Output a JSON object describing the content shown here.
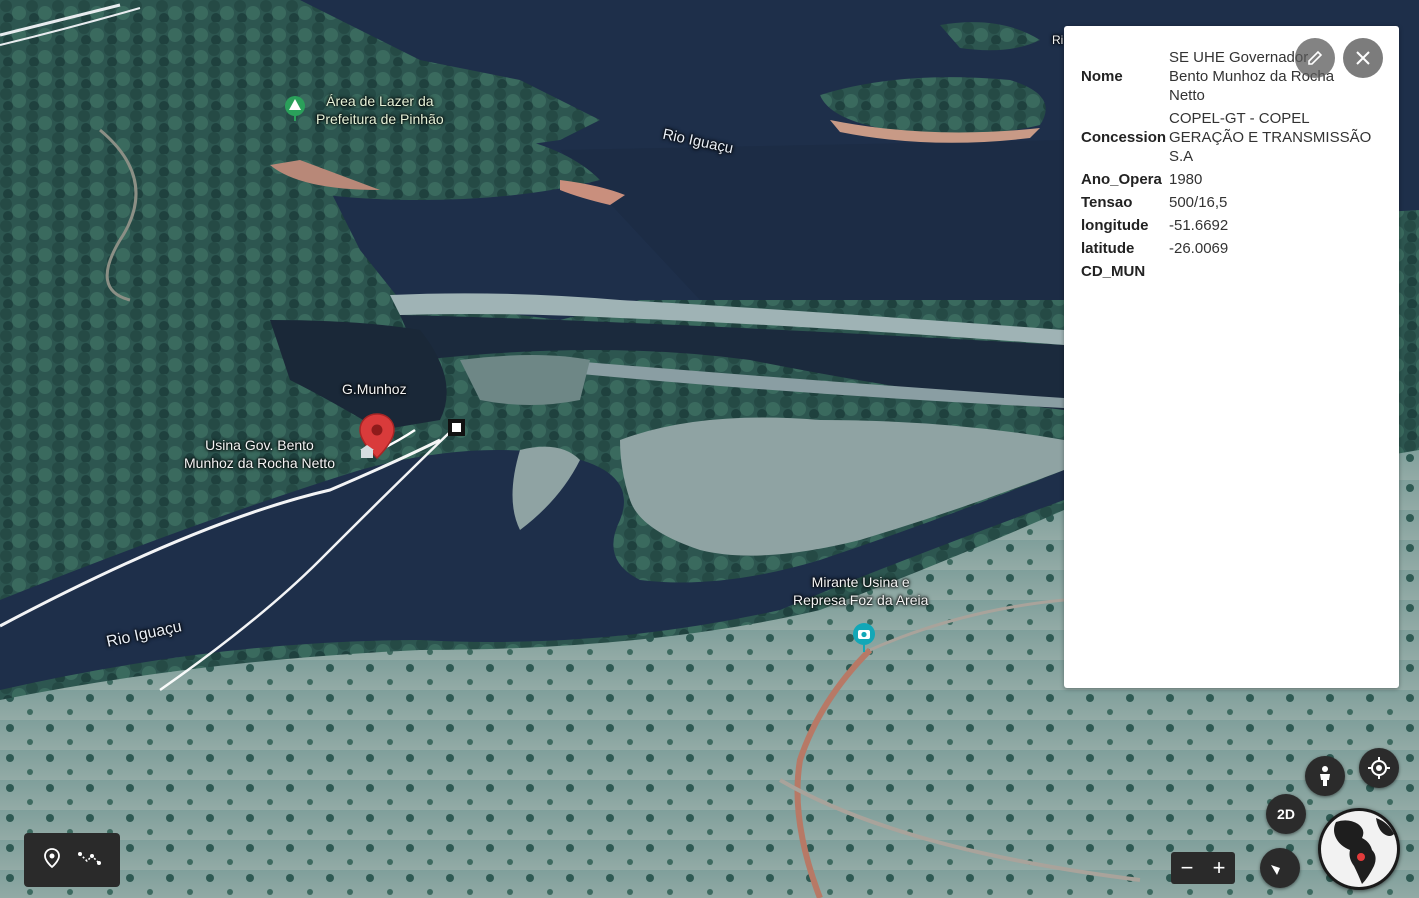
{
  "map": {
    "labels": {
      "area_lazer": "Área de Lazer da\nPrefeitura de Pinhão",
      "rio_iguacu_top": "Rio Iguaçu",
      "rio_iguacu_bottom": "Rio Iguaçu",
      "g_munhoz": "G.Munhoz",
      "usina": "Usina Gov. Bento\nMunhoz da Rocha Netto",
      "mirante": "Mirante Usina e\nRepresa Foz da Areia",
      "corner_partial": "Ri"
    },
    "colors": {
      "water": "#1e2f4a",
      "forest": "#2f5a52",
      "field": "#8aa7a4",
      "marker": "#d93b3b"
    }
  },
  "info_panel": {
    "rows": [
      {
        "key": "Nome",
        "value": "SE UHE Governador Bento Munhoz da Rocha Netto"
      },
      {
        "key": "Concession",
        "value": "COPEL-GT - COPEL GERAÇÃO E TRANSMISSÃO S.A"
      },
      {
        "key": "Ano_Opera",
        "value": "1980"
      },
      {
        "key": "Tensao",
        "value": "500/16,5"
      },
      {
        "key": "longitude",
        "value": "-51.6692"
      },
      {
        "key": "latitude",
        "value": "-26.0069"
      },
      {
        "key": "CD_MUN",
        "value": ""
      }
    ],
    "edit_icon": "pencil-icon",
    "close_icon": "close-icon"
  },
  "controls": {
    "mode_2d_label": "2D",
    "zoom_out_label": "−",
    "zoom_in_label": "+",
    "icons": [
      "place-marker-icon",
      "path-line-icon",
      "pegman-icon",
      "my-location-icon",
      "compass-icon",
      "globe-icon"
    ]
  }
}
